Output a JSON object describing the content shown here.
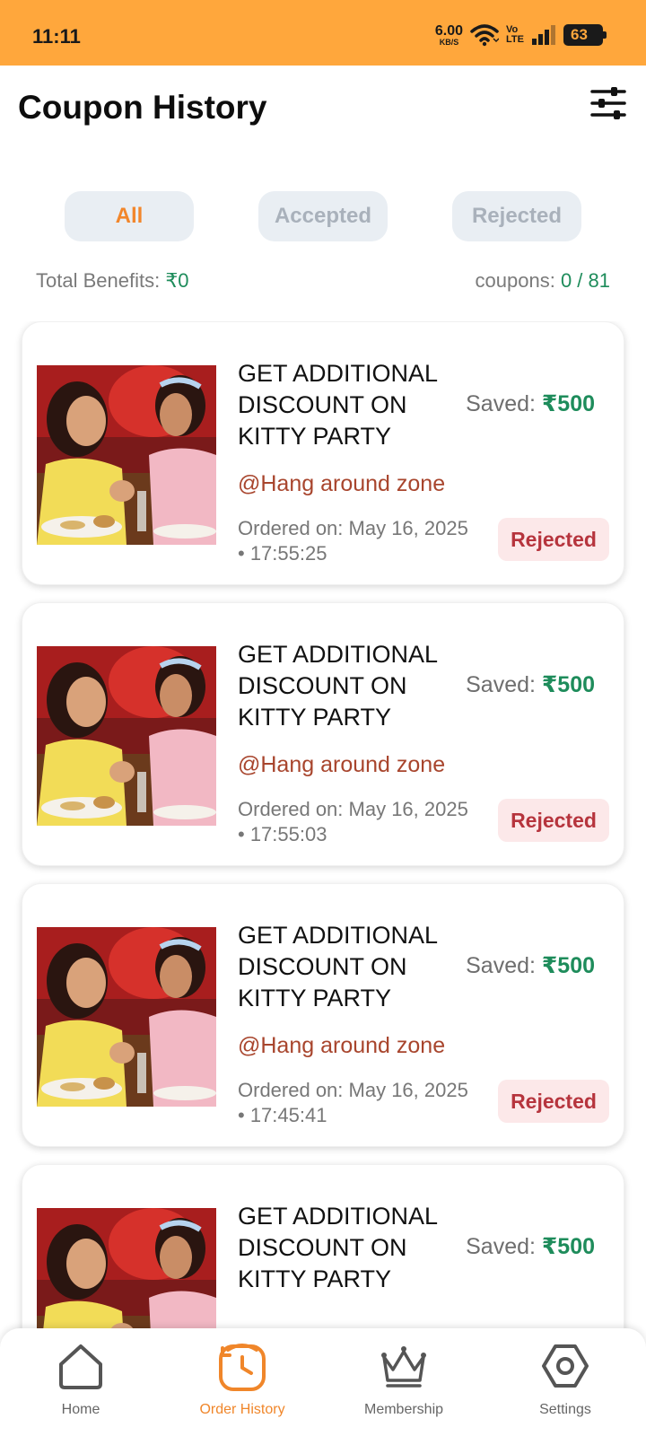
{
  "status_bar": {
    "time": "11:11",
    "net_speed": "6.00",
    "net_unit": "KB/S",
    "volte_top": "Vo",
    "volte_bottom": "LTE",
    "battery": "63"
  },
  "header": {
    "title": "Coupon History",
    "filter_icon": "sliders-icon"
  },
  "tabs": [
    {
      "label": "All",
      "active": true
    },
    {
      "label": "Accepted",
      "active": false
    },
    {
      "label": "Rejected",
      "active": false
    }
  ],
  "summary": {
    "benefits_label": "Total Benefits: ",
    "benefits_value": "₹0",
    "coupons_label": "coupons: ",
    "coupons_value": "0 / 81"
  },
  "cards": [
    {
      "title": "GET  ADDITIONAL\nDISCOUNT ON\nKITTY PARTY",
      "saved_label": "Saved: ",
      "saved_value": "₹500",
      "vendor": "@Hang around zone",
      "ordered": "Ordered on: May 16, 2025\n• 17:55:25",
      "status": "Rejected"
    },
    {
      "title": "GET  ADDITIONAL\nDISCOUNT ON\nKITTY PARTY",
      "saved_label": "Saved: ",
      "saved_value": "₹500",
      "vendor": "@Hang around zone",
      "ordered": "Ordered on: May 16, 2025\n• 17:55:03",
      "status": "Rejected"
    },
    {
      "title": "GET  ADDITIONAL\nDISCOUNT ON\nKITTY PARTY",
      "saved_label": "Saved: ",
      "saved_value": "₹500",
      "vendor": "@Hang around zone",
      "ordered": "Ordered on: May 16, 2025\n• 17:45:41",
      "status": "Rejected"
    },
    {
      "title": "GET  ADDITIONAL\nDISCOUNT ON\nKITTY PARTY",
      "saved_label": "Saved: ",
      "saved_value": "₹500",
      "vendor": "",
      "ordered": "",
      "status": ""
    }
  ],
  "bottom_nav": [
    {
      "label": "Home",
      "icon": "home-icon",
      "active": false
    },
    {
      "label": "Order History",
      "icon": "history-icon",
      "active": true
    },
    {
      "label": "Membership",
      "icon": "crown-icon",
      "active": false
    },
    {
      "label": "Settings",
      "icon": "settings-icon",
      "active": false
    }
  ],
  "colors": {
    "status_bar": "#FFA73C",
    "accent": "#F2862B",
    "green": "#1E8C5B",
    "vendor": "#A8452D",
    "rejected_text": "#B6343D",
    "rejected_bg": "#FCE8E9"
  }
}
